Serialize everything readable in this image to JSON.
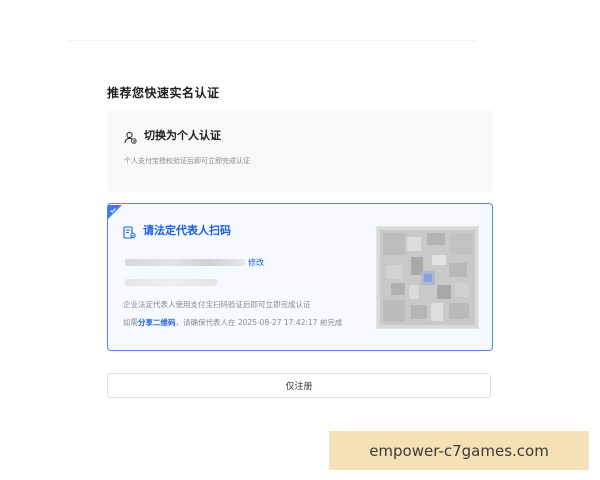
{
  "section_title": "推荐您快速实名认证",
  "personal_option": {
    "icon": "user-switch-icon",
    "title": "切换为个人认证",
    "description": "个人支付宝授权验证后即可立即完成认证"
  },
  "legal_option": {
    "icon": "document-scan-icon",
    "title": "请法定代表人扫码",
    "modify_label": "修改",
    "description": "企业法定代表人使用支付宝扫码验证后即可立即完成认证",
    "share_prefix": "如需",
    "share_link": "分享二维码",
    "share_suffix": "，请确保代表人在 2025-08-27 17:42:17 前完成",
    "qr_code": "qr-code",
    "accent_color": "#1a5fe0"
  },
  "register_button": {
    "label": "仅注册"
  },
  "watermark": {
    "text": "empower-c7games.com"
  }
}
